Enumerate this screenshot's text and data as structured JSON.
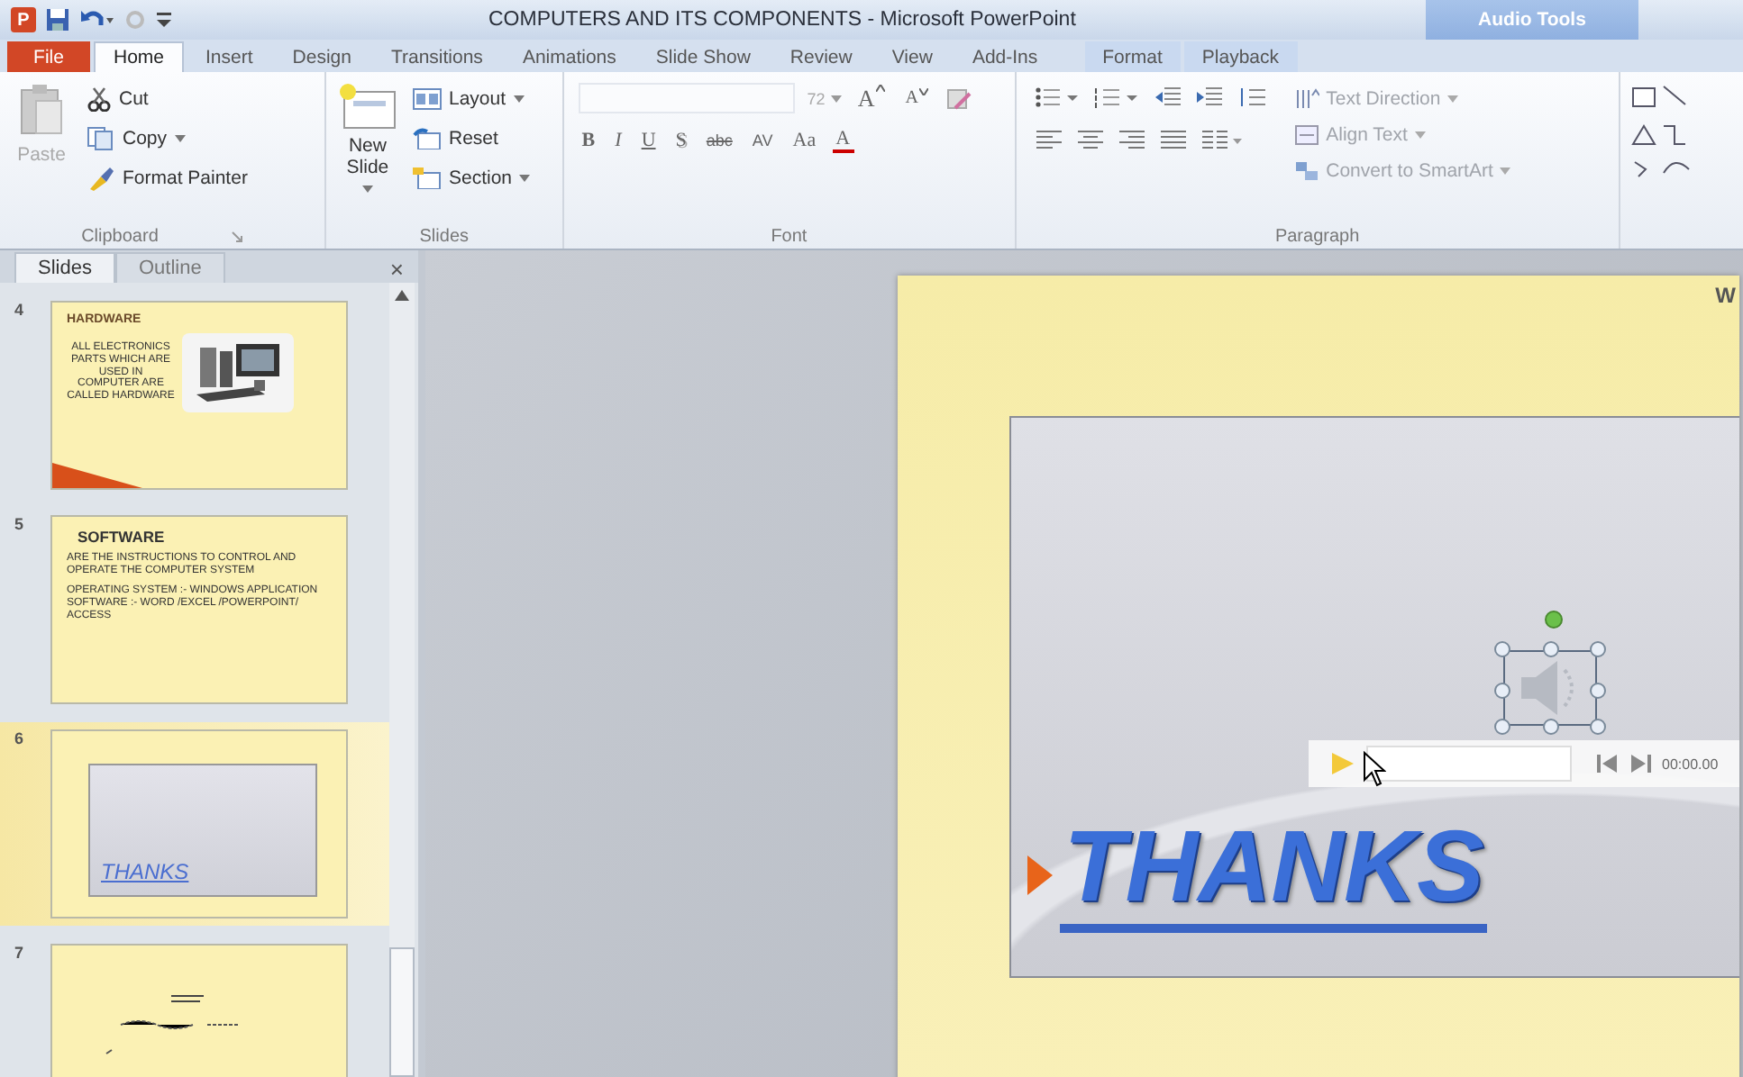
{
  "window": {
    "app_icon": "P",
    "title": "COMPUTERS AND ITS COMPONENTS - Microsoft PowerPoint",
    "contextual_group": "Audio Tools"
  },
  "tabs": [
    {
      "label": "File",
      "kind": "file",
      "selected": false
    },
    {
      "label": "Home",
      "kind": "normal",
      "selected": true
    },
    {
      "label": "Insert",
      "kind": "normal",
      "selected": false
    },
    {
      "label": "Design",
      "kind": "normal",
      "selected": false
    },
    {
      "label": "Transitions",
      "kind": "normal",
      "selected": false
    },
    {
      "label": "Animations",
      "kind": "normal",
      "selected": false
    },
    {
      "label": "Slide Show",
      "kind": "normal",
      "selected": false
    },
    {
      "label": "Review",
      "kind": "normal",
      "selected": false
    },
    {
      "label": "View",
      "kind": "normal",
      "selected": false
    },
    {
      "label": "Add-Ins",
      "kind": "normal",
      "selected": false
    },
    {
      "label": "Format",
      "kind": "contextual",
      "selected": false
    },
    {
      "label": "Playback",
      "kind": "contextual",
      "selected": false
    }
  ],
  "ribbon": {
    "clipboard": {
      "label": "Clipboard",
      "paste": "Paste",
      "paste_disabled": true,
      "cut": "Cut",
      "copy": "Copy",
      "format_painter": "Format Painter"
    },
    "slides": {
      "label": "Slides",
      "new_slide": "New Slide",
      "layout": "Layout",
      "reset": "Reset",
      "section": "Section"
    },
    "font": {
      "label": "Font",
      "size": "72",
      "grow": "A",
      "shrink": "A",
      "buttons": [
        {
          "label": "B",
          "kind": "bold"
        },
        {
          "label": "I",
          "kind": "italic"
        },
        {
          "label": "U",
          "kind": "underline"
        },
        {
          "label": "S",
          "kind": "shadow"
        },
        {
          "label": "abc",
          "kind": "strike"
        },
        {
          "label": "AV",
          "kind": "spacing"
        },
        {
          "label": "Aa",
          "kind": "case"
        },
        {
          "label": "A",
          "kind": "color"
        }
      ]
    },
    "paragraph": {
      "label": "Paragraph",
      "text_direction": "Text Direction",
      "align_text": "Align Text",
      "convert": "Convert to SmartArt",
      "disabled": true
    }
  },
  "slides_pane": {
    "tabs": [
      {
        "label": "Slides",
        "selected": true
      },
      {
        "label": "Outline",
        "selected": false
      }
    ],
    "close": "×",
    "slides": [
      {
        "number": "4",
        "kind": "text_picture",
        "selected": false,
        "title": "HARDWARE",
        "body": [
          "ALL ELECTRONICS PARTS WHICH ARE USED IN COMPUTER ARE CALLED HARDWARE"
        ]
      },
      {
        "number": "5",
        "kind": "text",
        "selected": false,
        "title": "SOFTWARE",
        "body": [
          "ARE THE INSTRUCTIONS TO CONTROL AND OPERATE THE COMPUTER SYSTEM",
          "OPERATING SYSTEM :- WINDOWS APPLICATION SOFTWARE :- WORD /EXCEL /POWERPOINT/ ACCESS"
        ]
      },
      {
        "number": "6",
        "kind": "thanks",
        "selected": true,
        "title": "THANKS"
      },
      {
        "number": "7",
        "kind": "scribble",
        "selected": false
      }
    ]
  },
  "slide": {
    "corner_text": "W",
    "title": "THANKS",
    "audio": {
      "selected": true,
      "time": "00:00.00"
    }
  }
}
